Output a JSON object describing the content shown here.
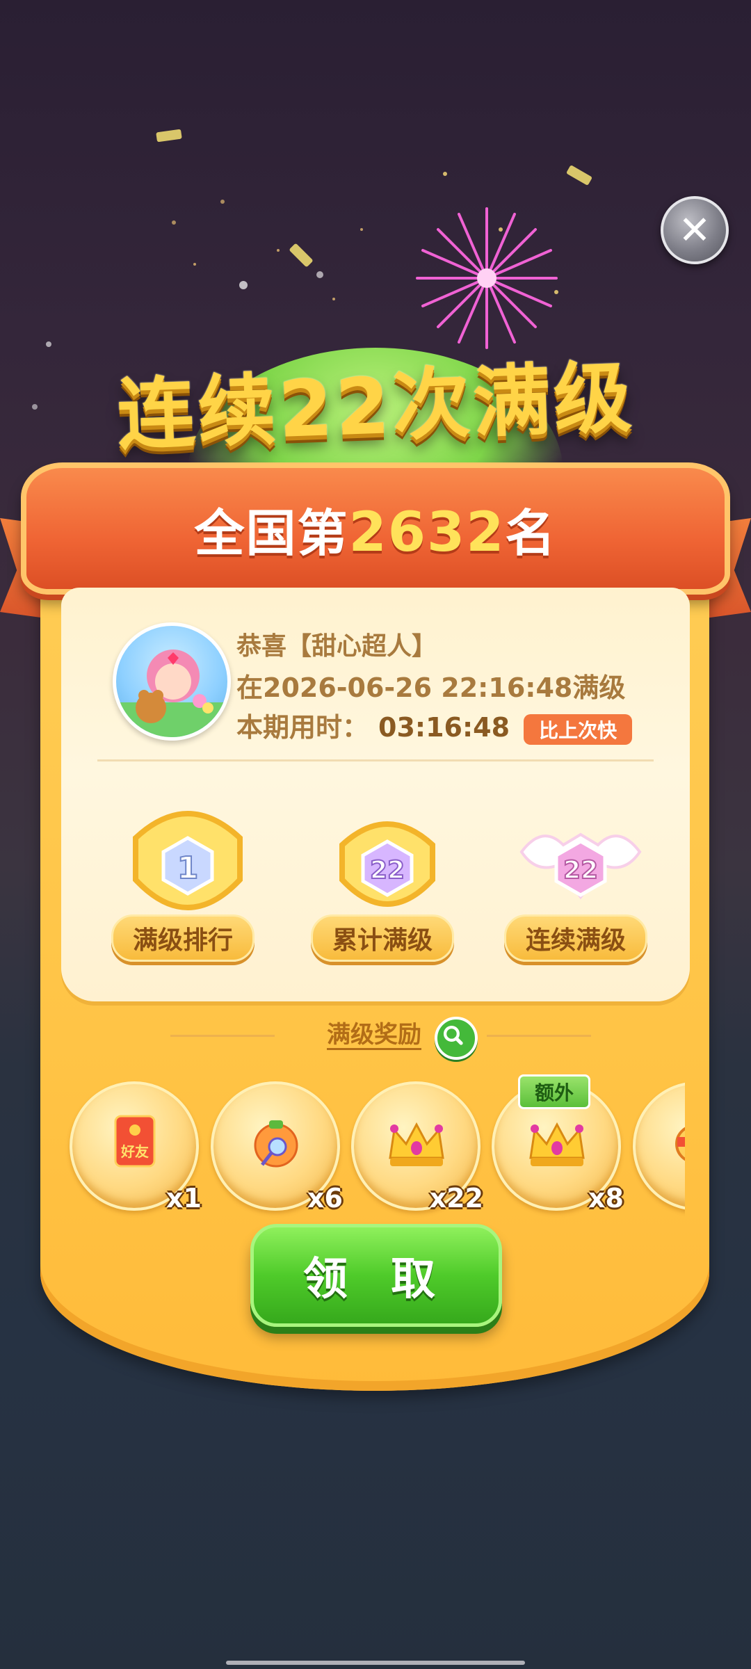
{
  "headline": "连续22次满级",
  "banner": {
    "prefix": "全国第",
    "rank": "2632",
    "suffix": "名"
  },
  "profile": {
    "congrats": "恭喜【甜心超人】",
    "completed_at": "在2026-06-26 22:16:48满级",
    "time_label": "本期用时：",
    "time_value": "03:16:48",
    "badge": "比上次快"
  },
  "badges": [
    {
      "label": "满级排行",
      "value": "1"
    },
    {
      "label": "累计满级",
      "value": "22"
    },
    {
      "label": "连续满级",
      "value": "22"
    }
  ],
  "rewards_title": "满级奖励",
  "extra_tag": "额外",
  "rewards": [
    {
      "icon": "red-envelope-icon",
      "icon_text": "好友",
      "count": "x1"
    },
    {
      "icon": "magic-wand-icon",
      "count": "x6"
    },
    {
      "icon": "crown-icon",
      "count": "x22"
    },
    {
      "icon": "crown-icon",
      "count": "x8"
    },
    {
      "icon": "partial-reward-icon",
      "count": ""
    }
  ],
  "claim_button": "领 取",
  "close_icon": "close-icon",
  "colors": {
    "panel": "#ffc446",
    "banner": "#ef6434",
    "rank": "#ffe25a",
    "button": "#4fcb2a"
  }
}
